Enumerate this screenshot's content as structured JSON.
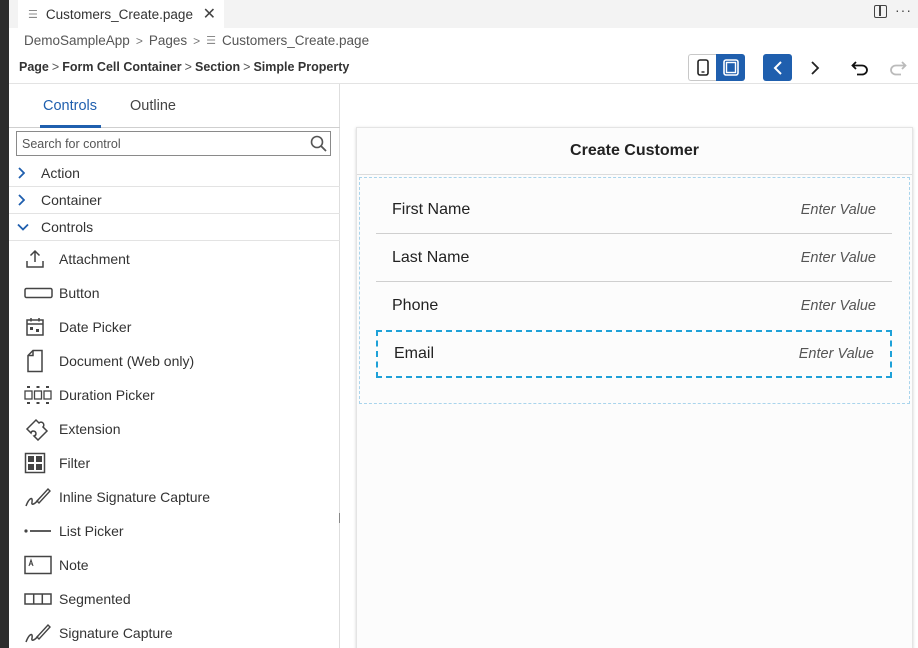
{
  "editor_tab": {
    "title": "Customers_Create.page",
    "file_icon": "page-file-icon",
    "close_glyph": "✕"
  },
  "window_actions": {
    "more_glyph": "···"
  },
  "breadcrumb": {
    "items": [
      "DemoSampleApp",
      "Pages",
      "Customers_Create.page"
    ],
    "separator": ">"
  },
  "path": {
    "items": [
      "Page",
      "Form Cell Container",
      "Section",
      "Simple Property"
    ],
    "separator": ">"
  },
  "toolbar": {
    "device_modes": [
      "phone",
      "tablet"
    ],
    "selected_device": "tablet",
    "accent_color": "#1f5fae"
  },
  "left_panel": {
    "tabs": [
      {
        "label": "Controls",
        "active": true
      },
      {
        "label": "Outline",
        "active": false
      }
    ],
    "search": {
      "placeholder": "Search for control",
      "value": ""
    },
    "categories": [
      {
        "label": "Action",
        "expanded": false
      },
      {
        "label": "Container",
        "expanded": false
      },
      {
        "label": "Controls",
        "expanded": true
      }
    ],
    "controls": [
      {
        "label": "Attachment",
        "icon": "attachment-icon"
      },
      {
        "label": "Button",
        "icon": "button-icon"
      },
      {
        "label": "Date Picker",
        "icon": "calendar-icon"
      },
      {
        "label": "Document (Web only)",
        "icon": "document-icon"
      },
      {
        "label": "Duration Picker",
        "icon": "duration-icon"
      },
      {
        "label": "Extension",
        "icon": "extension-icon"
      },
      {
        "label": "Filter",
        "icon": "filter-icon"
      },
      {
        "label": "Inline Signature Capture",
        "icon": "signature-icon"
      },
      {
        "label": "List Picker",
        "icon": "list-picker-icon"
      },
      {
        "label": "Note",
        "icon": "note-icon"
      },
      {
        "label": "Segmented",
        "icon": "segmented-icon"
      },
      {
        "label": "Signature Capture",
        "icon": "signature-icon"
      }
    ]
  },
  "preview": {
    "title": "Create Customer",
    "rows": [
      {
        "label": "First Name",
        "placeholder": "Enter Value",
        "selected": false
      },
      {
        "label": "Last Name",
        "placeholder": "Enter Value",
        "selected": false
      },
      {
        "label": "Phone",
        "placeholder": "Enter Value",
        "selected": false
      },
      {
        "label": "Email",
        "placeholder": "Enter Value",
        "selected": true
      }
    ],
    "selection_color": "#1ea1d8"
  }
}
